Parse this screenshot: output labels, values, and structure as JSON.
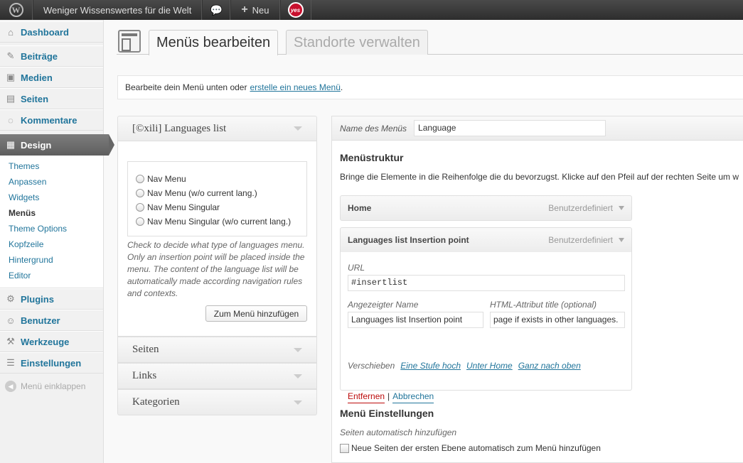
{
  "adminbar": {
    "site_name": "Weniger Wissenswertes für die Welt",
    "new_label": "Neu",
    "plugin_badge": "yes"
  },
  "sidebar": {
    "items": [
      {
        "label": "Dashboard",
        "icon": "dashboard-icon"
      },
      {
        "label": "Beiträge",
        "icon": "pin-icon"
      },
      {
        "label": "Medien",
        "icon": "media-icon"
      },
      {
        "label": "Seiten",
        "icon": "page-icon"
      },
      {
        "label": "Kommentare",
        "icon": "comment-icon"
      },
      {
        "label": "Design",
        "icon": "appearance-icon"
      }
    ],
    "design_submenu": [
      "Themes",
      "Anpassen",
      "Widgets",
      "Menüs",
      "Theme Options",
      "Kopfzeile",
      "Hintergrund",
      "Editor"
    ],
    "items_after": [
      {
        "label": "Plugins",
        "icon": "plugin-icon"
      },
      {
        "label": "Benutzer",
        "icon": "users-icon"
      },
      {
        "label": "Werkzeuge",
        "icon": "tools-icon"
      },
      {
        "label": "Einstellungen",
        "icon": "settings-icon"
      }
    ],
    "collapse_label": "Menü einklappen"
  },
  "tabs": {
    "edit": "Menüs bearbeiten",
    "locations": "Standorte verwalten"
  },
  "notice": {
    "text": "Bearbeite dein Menü unten oder",
    "link": "erstelle ein neues Menü",
    "suffix": "."
  },
  "languages_box": {
    "title": "[©xili] Languages list",
    "options": [
      "Nav Menu",
      "Nav Menu (w/o current lang.)",
      "Nav Menu Singular",
      "Nav Menu Singular (w/o current lang.)"
    ],
    "help": "Check to decide what type of languages menu. Only an insertion point will be placed inside the menu. The content of the language list will be automatically made according navigation rules and contexts.",
    "add_button": "Zum Menü hinzufügen"
  },
  "other_boxes": [
    "Seiten",
    "Links",
    "Kategorien"
  ],
  "menu": {
    "name_label": "Name des Menüs",
    "name_value": "Language",
    "structure_title": "Menüstruktur",
    "structure_desc": "Bringe die Elemente in die Reihenfolge die du bevorzugst. Klicke auf den Pfeil auf der rechten Seite um w",
    "items": [
      {
        "title": "Home",
        "type": "Benutzerdefiniert"
      },
      {
        "title": "Languages list Insertion point",
        "type": "Benutzerdefiniert"
      }
    ],
    "url_label": "URL",
    "url_value": "#insertlist",
    "nav_label_label": "Angezeigter Name",
    "nav_label_value": "Languages list Insertion point",
    "title_attr_label": "HTML-Attribut title (optional)",
    "title_attr_value": "page if exists in other languages.",
    "move_label": "Verschieben",
    "move_links": [
      "Eine Stufe hoch",
      "Unter Home",
      "Ganz nach oben"
    ],
    "remove": "Entfernen",
    "separator": "|",
    "cancel": "Abbrechen",
    "settings_title": "Menü Einstellungen",
    "auto_add_label": "Seiten automatisch hinzufügen",
    "auto_add_text": "Neue Seiten der ersten Ebene automatisch zum Menü hinzufügen"
  }
}
